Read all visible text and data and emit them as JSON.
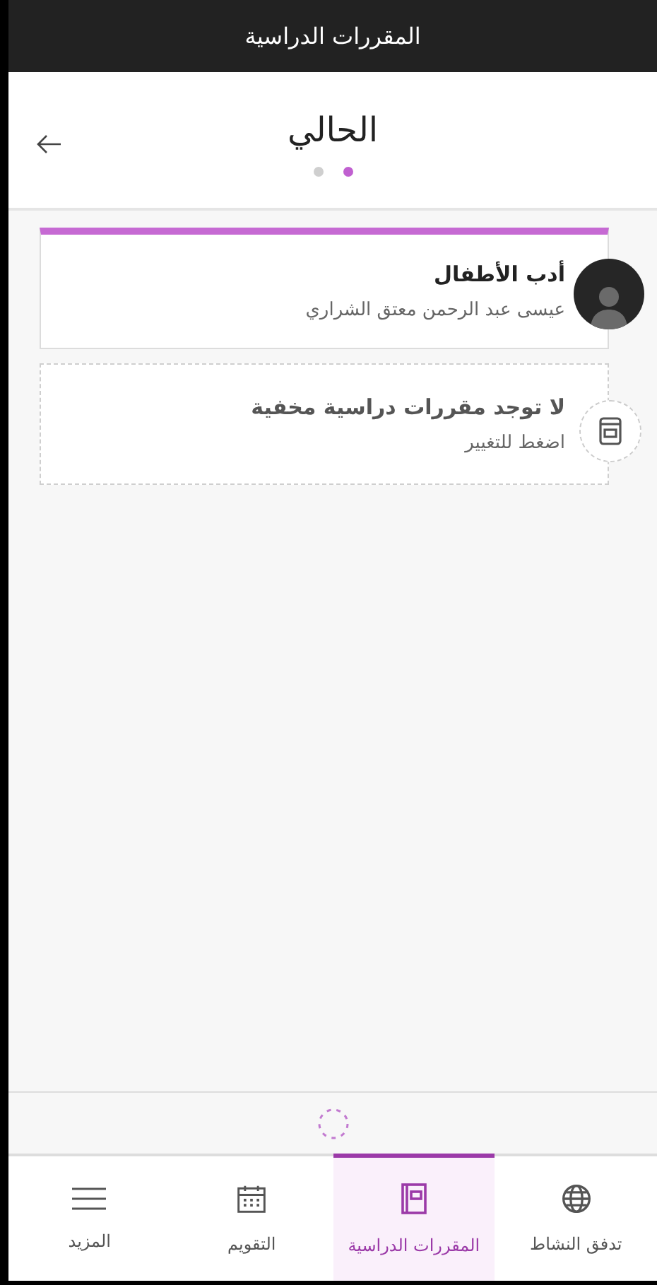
{
  "app_bar": {
    "title": "المقررات الدراسية"
  },
  "header": {
    "title": "الحالي",
    "pages": [
      {
        "selected": true
      },
      {
        "selected": false
      }
    ]
  },
  "courses": [
    {
      "kind": "course",
      "title": "أدب الأطفال",
      "subtitle": "عيسى عبد الرحمن معتق الشراري",
      "highlighted": true
    },
    {
      "kind": "hidden",
      "title": "لا توجد مقررات دراسية مخفية",
      "subtitle": "اضغط للتغيير",
      "highlighted": false
    }
  ],
  "nav": [
    {
      "kind": "globe",
      "label": "تدفق النشاط",
      "selected": false
    },
    {
      "kind": "book",
      "label": "المقررات الدراسية",
      "selected": true
    },
    {
      "kind": "calendar",
      "label": "التقويم",
      "selected": false
    },
    {
      "kind": "menu",
      "label": "المزيد",
      "selected": false
    }
  ]
}
